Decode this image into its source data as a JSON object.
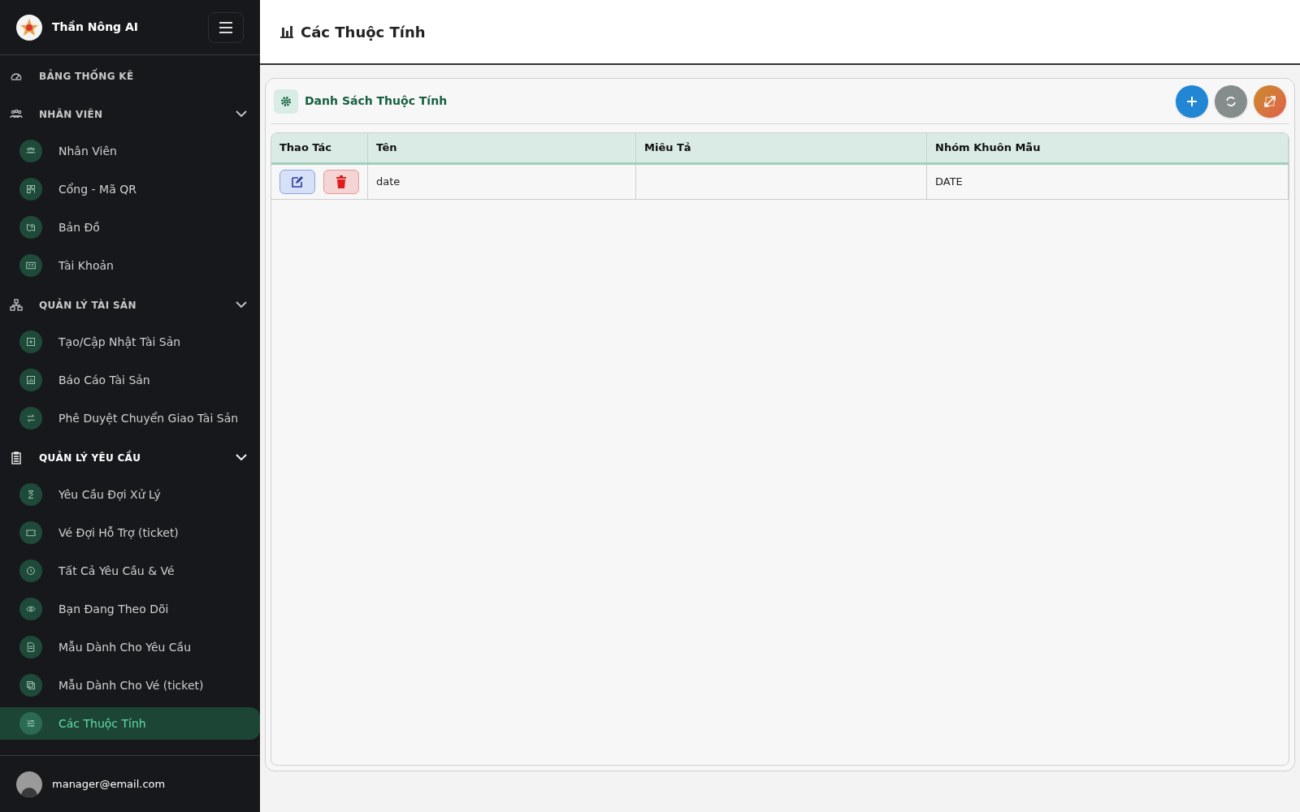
{
  "sidebar": {
    "brand": "Thần Nông AI",
    "groups": [
      {
        "label": "BẢNG THỐNG KÊ",
        "highlighted": false
      },
      {
        "label": "NHÂN VIÊN",
        "highlighted": false,
        "expanded": true,
        "children": [
          {
            "label": "Nhân Viên",
            "selected": false
          },
          {
            "label": "Cổng - Mã QR",
            "selected": false
          },
          {
            "label": "Bản Đồ",
            "selected": false
          },
          {
            "label": "Tài Khoản",
            "selected": false
          }
        ]
      },
      {
        "label": "QUẢN LÝ TÀI SẢN",
        "highlighted": false,
        "expanded": true,
        "children": [
          {
            "label": "Tạo/Cập Nhật Tài Sản",
            "selected": false
          },
          {
            "label": "Báo Cáo Tài Sản",
            "selected": false
          },
          {
            "label": "Phê Duyệt Chuyển Giao Tài Sản",
            "selected": false
          }
        ]
      },
      {
        "label": "QUẢN LÝ YÊU CẦU",
        "highlighted": true,
        "expanded": true,
        "children": [
          {
            "label": "Yêu Cầu Đợi Xử Lý",
            "selected": false
          },
          {
            "label": "Vé Đợi Hỗ Trợ (ticket)",
            "selected": false
          },
          {
            "label": "Tất Cả Yêu Cầu & Vé",
            "selected": false
          },
          {
            "label": "Bạn Đang Theo Dõi",
            "selected": false
          },
          {
            "label": "Mẫu Dành Cho Yêu Cầu",
            "selected": false
          },
          {
            "label": "Mẫu Dành Cho Vé (ticket)",
            "selected": false
          },
          {
            "label": "Các Thuộc Tính",
            "selected": true
          }
        ]
      }
    ],
    "user": "manager@email.com"
  },
  "page_title": "Các Thuộc Tính",
  "card": {
    "title": "Danh Sách Thuộc Tính",
    "table": {
      "columns": [
        "Thao Tác",
        "Tên",
        "Miêu Tả",
        "Nhóm Khuôn Mẫu"
      ],
      "rows": [
        {
          "name": "date",
          "group": "DATE"
        }
      ]
    }
  }
}
